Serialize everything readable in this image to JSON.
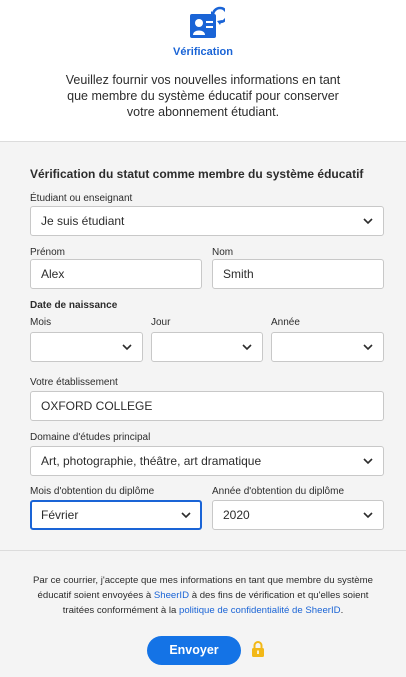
{
  "header": {
    "title": "Vérification",
    "intro": "Veuillez fournir vos nouvelles informations en tant que membre du système éducatif pour conserver votre abonnement étudiant."
  },
  "form": {
    "section_title": "Vérification du statut comme membre du système éducatif",
    "status": {
      "label": "Étudiant ou enseignant",
      "value": "Je suis étudiant"
    },
    "first_name": {
      "label": "Prénom",
      "value": "Alex"
    },
    "last_name": {
      "label": "Nom",
      "value": "Smith"
    },
    "birth_date": {
      "label": "Date de naissance",
      "month_label": "Mois",
      "day_label": "Jour",
      "year_label": "Année",
      "month_value": "",
      "day_value": "",
      "year_value": ""
    },
    "school": {
      "label": "Votre établissement",
      "value": "OXFORD COLLEGE"
    },
    "field_of_study": {
      "label": "Domaine d'études principal",
      "value": "Art, photographie, théâtre, art dramatique"
    },
    "grad_month": {
      "label": "Mois d'obtention du diplôme",
      "value": "Février"
    },
    "grad_year": {
      "label": "Année d'obtention du diplôme",
      "value": "2020"
    }
  },
  "footer": {
    "consent_part1": "Par ce courrier, j'accepte que mes informations en tant que membre du système éducatif soient envoyées à ",
    "consent_link1": "SheerID",
    "consent_part2": " à des fins de vérification et qu'elles soient traitées conformément à la ",
    "consent_link2": "politique de confidentialité de SheerID",
    "consent_part3": ".",
    "submit_label": "Envoyer"
  },
  "colors": {
    "accent": "#1473e6",
    "link": "#1a64d6",
    "panel": "#f4f4f4",
    "lock": "#f2b817"
  },
  "icons": {
    "logo": "id-card-refresh-icon",
    "dropdown": "chevron-down-icon",
    "lock": "lock-icon"
  }
}
